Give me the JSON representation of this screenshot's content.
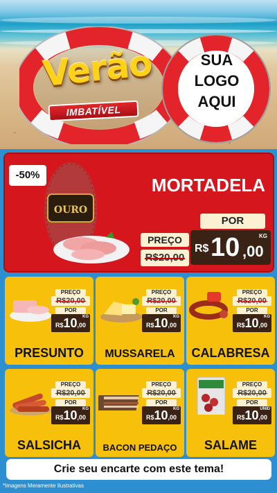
{
  "header": {
    "title": "Verão",
    "subtitle": "IMBATÍVEL",
    "logo_placeholder": [
      "SUA",
      "LOGO",
      "AQUI"
    ]
  },
  "featured": {
    "discount": "-50%",
    "name": "MORTADELA",
    "brand_label": "OURO",
    "preco_label": "PREÇO",
    "por_label": "POR",
    "old_price": "R$20,00",
    "currency": "R$",
    "new_price_int": "10",
    "new_price_dec": ",00",
    "unit": "KG"
  },
  "products": [
    {
      "name": "PRESUNTO",
      "preco_label": "PREÇO",
      "old_price": "R$20,00",
      "por_label": "POR",
      "currency": "R$",
      "price_int": "10",
      "price_dec": ",00",
      "unit": "KG"
    },
    {
      "name": "MUSSARELA",
      "preco_label": "PREÇO",
      "old_price": "R$20,00",
      "por_label": "POR",
      "currency": "R$",
      "price_int": "10",
      "price_dec": ",00",
      "unit": "KG"
    },
    {
      "name": "CALABRESA",
      "preco_label": "PREÇO",
      "old_price": "R$20,00",
      "por_label": "POR",
      "currency": "R$",
      "price_int": "10",
      "price_dec": ",00",
      "unit": "KG"
    },
    {
      "name": "SALSICHA",
      "preco_label": "PREÇO",
      "old_price": "R$20,00",
      "por_label": "POR",
      "currency": "R$",
      "price_int": "10",
      "price_dec": ",00",
      "unit": "KG"
    },
    {
      "name": "BACON PEDAÇO",
      "preco_label": "PREÇO",
      "old_price": "R$20,00",
      "por_label": "POR",
      "currency": "R$",
      "price_int": "10",
      "price_dec": ",00",
      "unit": "KG"
    },
    {
      "name": "SALAME",
      "preco_label": "PREÇO",
      "old_price": "R$20,00",
      "por_label": "POR",
      "currency": "R$",
      "price_int": "10",
      "price_dec": ",00",
      "unit": "UNID"
    }
  ],
  "footer": {
    "cta": "Crie seu encarte com este tema!",
    "disclaimer": "*Imagens Meramente Ilustrativas"
  },
  "colors": {
    "background": "#2d8fd0",
    "red": "#d6161d",
    "yellow": "#f7c10b",
    "price_dark": "#3a2314",
    "price_light": "#fbf0d2"
  },
  "icons": {
    "lifebuoy": "lifebuoy-icon",
    "mortadela": "mortadela-image",
    "presunto": "ham-slices-image",
    "mussarela": "cheese-image",
    "calabresa": "sausage-ring-image",
    "salsicha": "hotdog-sausages-image",
    "bacon": "bacon-slab-image",
    "salame": "salami-pack-image"
  }
}
